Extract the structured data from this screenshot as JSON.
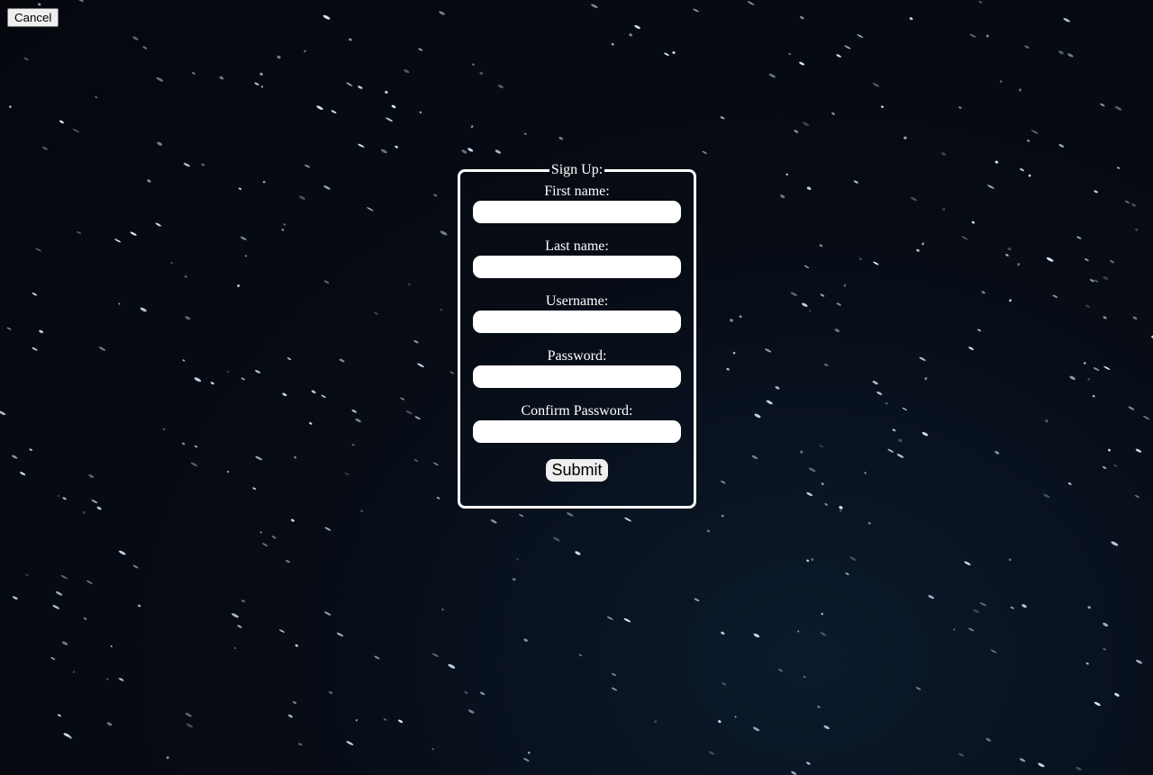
{
  "page": {
    "background_color": "#05070d"
  },
  "toolbar": {
    "cancel_label": "Cancel"
  },
  "signup": {
    "legend": "Sign Up:",
    "fields": [
      {
        "label": "First name:",
        "value": "",
        "placeholder": ""
      },
      {
        "label": "Last name:",
        "value": "",
        "placeholder": ""
      },
      {
        "label": "Username:",
        "value": "",
        "placeholder": ""
      },
      {
        "label": "Password:",
        "value": "",
        "placeholder": ""
      },
      {
        "label": "Confirm Password:",
        "value": "",
        "placeholder": ""
      }
    ],
    "submit_label": "Submit"
  },
  "colors": {
    "text": "#ffffff",
    "border": "#ffffff",
    "star": "#d8ecff",
    "button_bg": "#efefef"
  }
}
